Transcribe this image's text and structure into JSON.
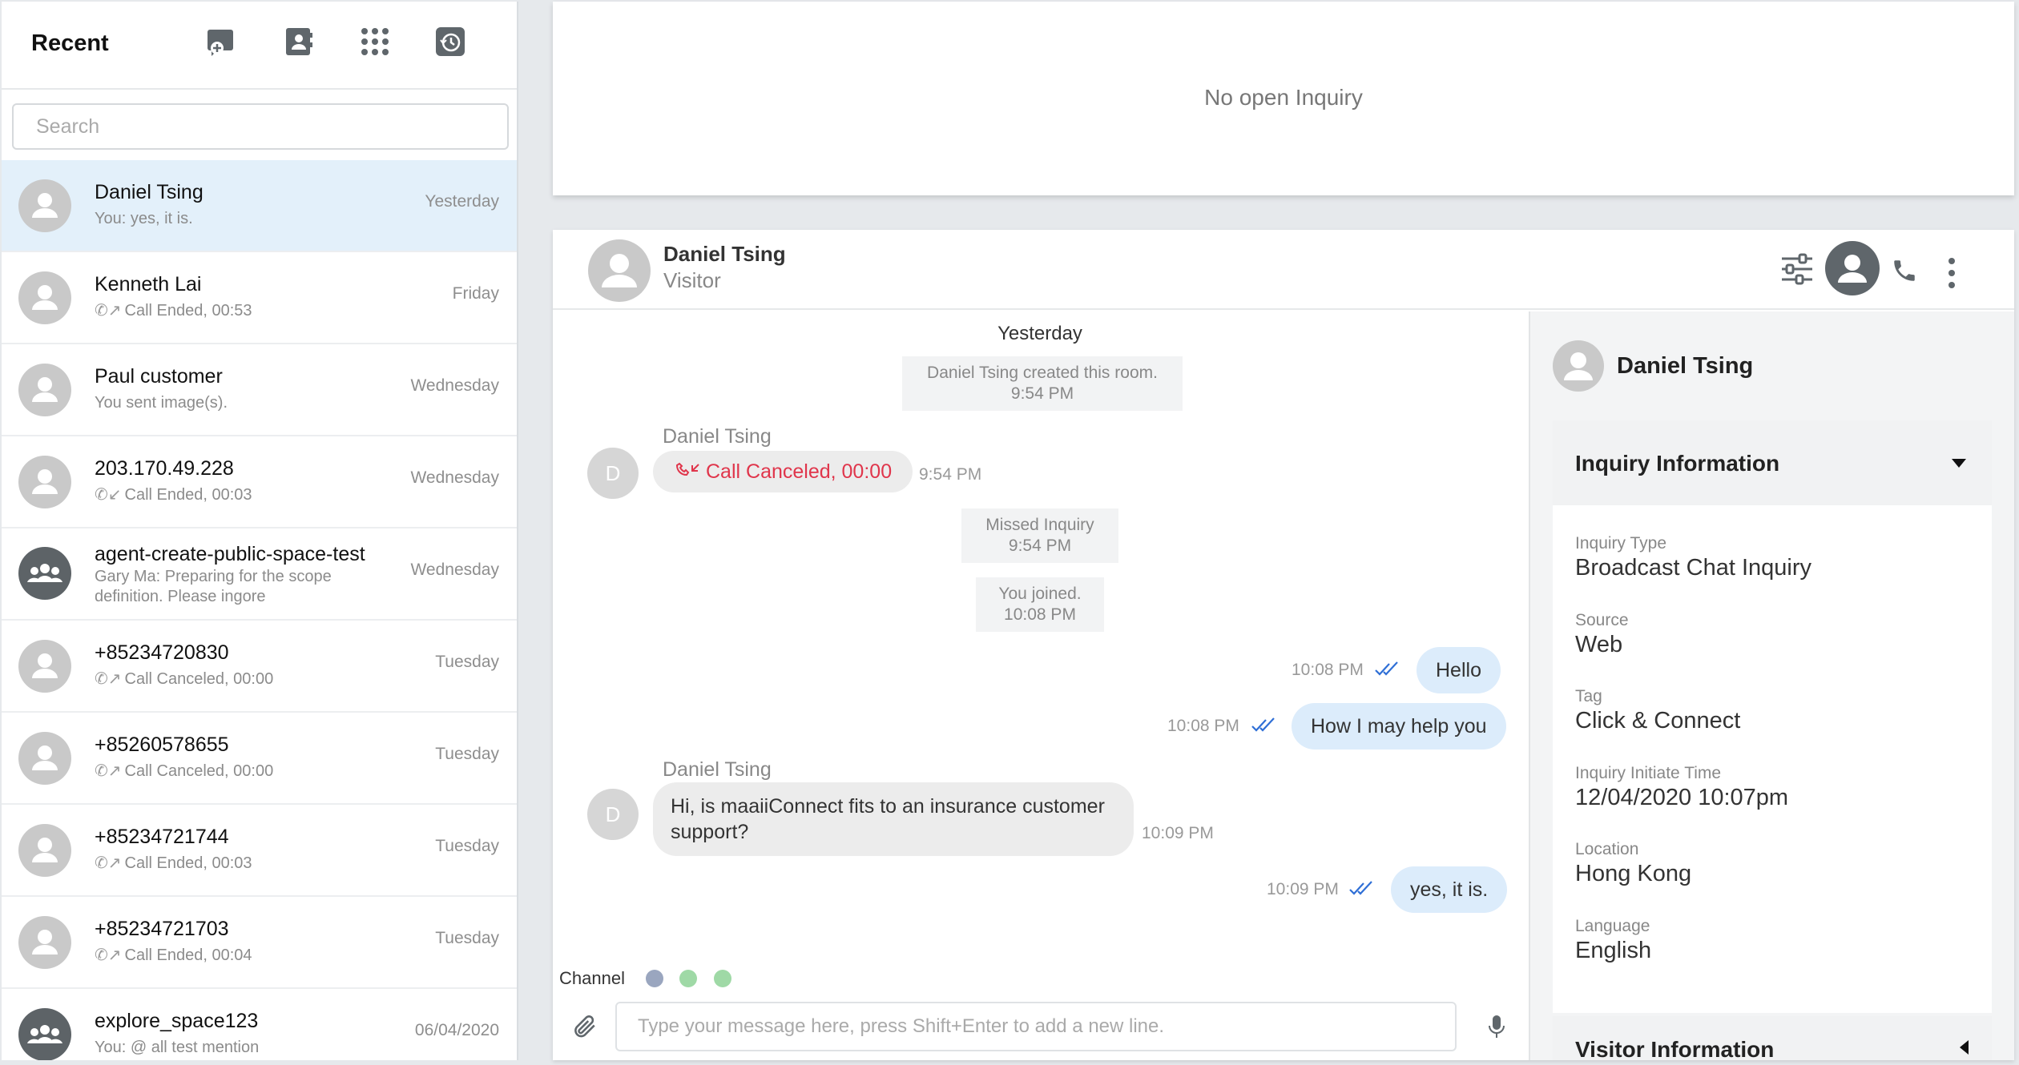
{
  "left": {
    "title": "Recent",
    "icons": [
      "new-chat-icon",
      "contacts-icon",
      "dialpad-icon",
      "history-icon"
    ],
    "search_placeholder": "Search"
  },
  "conversations": [
    {
      "name": "Daniel Tsing",
      "preview": "You: yes, it is.",
      "time": "Yesterday",
      "type": "person",
      "active": true,
      "call": ""
    },
    {
      "name": "Kenneth Lai",
      "preview": "Call Ended, 00:53",
      "time": "Friday",
      "type": "person",
      "call": "out"
    },
    {
      "name": "Paul customer",
      "preview": "You sent image(s).",
      "time": "Wednesday",
      "type": "person",
      "call": ""
    },
    {
      "name": "203.170.49.228",
      "preview": "Call Ended, 00:03",
      "time": "Wednesday",
      "type": "person",
      "call": "in"
    },
    {
      "name": "agent-create-public-space-test",
      "preview": "Gary Ma: Preparing for the scope definition. Please ingore",
      "time": "Wednesday",
      "type": "group",
      "call": ""
    },
    {
      "name": "+85234720830",
      "preview": "Call Canceled, 00:00",
      "time": "Tuesday",
      "type": "person",
      "call": "out"
    },
    {
      "name": "+85260578655",
      "preview": "Call Canceled, 00:00",
      "time": "Tuesday",
      "type": "person",
      "call": "out"
    },
    {
      "name": "+85234721744",
      "preview": "Call Ended, 00:03",
      "time": "Tuesday",
      "type": "person",
      "call": "out"
    },
    {
      "name": "+85234721703",
      "preview": "Call Ended, 00:04",
      "time": "Tuesday",
      "type": "person",
      "call": "out"
    },
    {
      "name": "explore_space123",
      "preview": "You: @ all test mention",
      "time": "06/04/2020",
      "type": "group",
      "call": ""
    }
  ],
  "inquiry_box": {
    "empty_text": "No open Inquiry"
  },
  "chat": {
    "contact_name": "Daniel Tsing",
    "contact_role": "Visitor",
    "date_separator": "Yesterday",
    "system_created": [
      "Daniel Tsing created this room.",
      "9:54 PM"
    ],
    "call_sender": "Daniel Tsing",
    "call_avatar_letter": "D",
    "call_text": "Call Canceled, 00:00",
    "call_time": "9:54 PM",
    "system_missed": [
      "Missed Inquiry",
      "9:54 PM"
    ],
    "system_joined": [
      "You joined.",
      "10:08 PM"
    ],
    "out1": {
      "text": "Hello",
      "time": "10:08 PM"
    },
    "out2": {
      "text": "How I may help you",
      "time": "10:08 PM"
    },
    "in_sender": "Daniel Tsing",
    "in_avatar_letter": "D",
    "in_msg": {
      "text": "Hi, is maaiiConnect fits to an insurance customer support?",
      "time": "10:09 PM"
    },
    "out3": {
      "text": "yes, it is.",
      "time": "10:09 PM"
    },
    "channel_label": "Channel",
    "composer_placeholder": "Type your message here, press Shift+Enter to add a new line.",
    "colors": {
      "accent": "#2f6fd6",
      "call_red": "#e0354b",
      "bubble_out": "#dcecfb"
    }
  },
  "info": {
    "name": "Daniel Tsing",
    "inquiry_title": "Inquiry Information",
    "fields": [
      {
        "label": "Inquiry Type",
        "value": "Broadcast Chat Inquiry"
      },
      {
        "label": "Source",
        "value": "Web"
      },
      {
        "label": "Tag",
        "value": "Click & Connect"
      },
      {
        "label": "Inquiry Initiate Time",
        "value": "12/04/2020 10:07pm"
      },
      {
        "label": "Location",
        "value": "Hong Kong"
      },
      {
        "label": "Language",
        "value": "English"
      }
    ],
    "visitor_title": "Visitor Information"
  }
}
